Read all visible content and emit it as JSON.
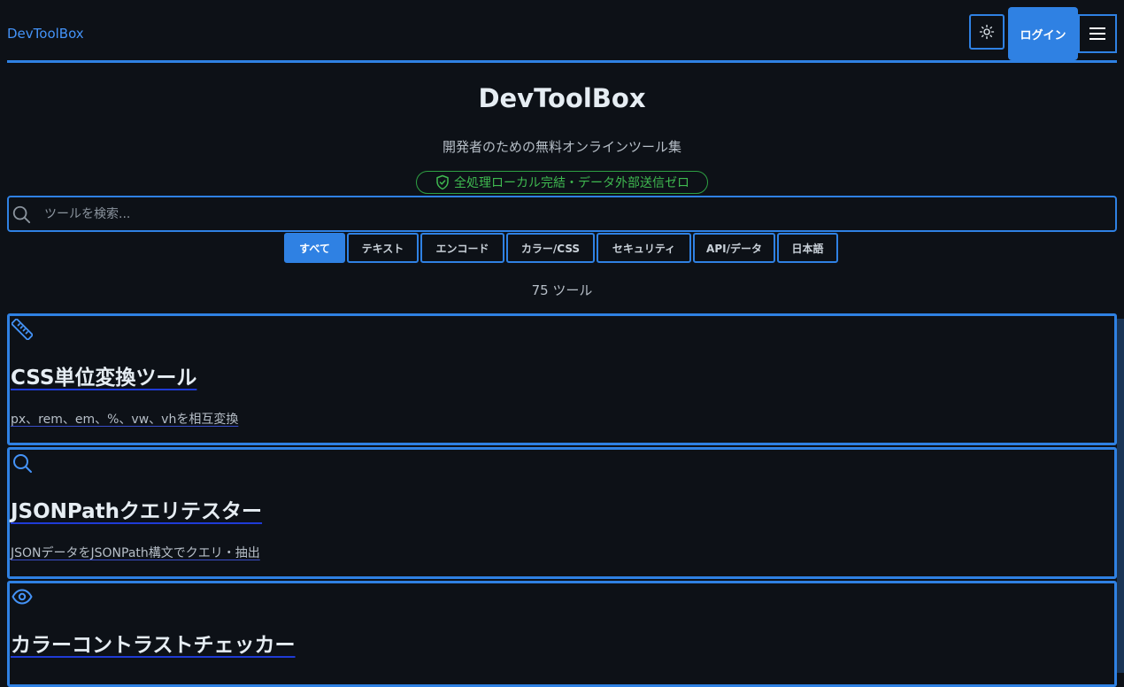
{
  "header": {
    "brand": "DevToolBox",
    "login_label": "ログイン",
    "theme_icon": "sun-icon",
    "menu_icon": "hamburger-menu-icon"
  },
  "hero": {
    "title": "DevToolBox",
    "subtitle": "開発者のための無料オンラインツール集",
    "privacy_badge": "全処理ローカル完結・データ外部送信ゼロ"
  },
  "search": {
    "placeholder": "ツールを検索..."
  },
  "tabs": [
    {
      "label": "すべて",
      "active": true
    },
    {
      "label": "テキスト",
      "active": false
    },
    {
      "label": "エンコード",
      "active": false
    },
    {
      "label": "カラー/CSS",
      "active": false
    },
    {
      "label": "セキュリティ",
      "active": false
    },
    {
      "label": "API/データ",
      "active": false
    },
    {
      "label": "日本語",
      "active": false
    }
  ],
  "count_label": "75 ツール",
  "tools": [
    {
      "icon": "ruler-icon",
      "title": "CSS単位変換ツール",
      "description": "px、rem、em、%、vw、vhを相互変換"
    },
    {
      "icon": "search-icon",
      "title": "JSONPathクエリテスター",
      "description": "JSONデータをJSONPath構文でクエリ・抽出"
    },
    {
      "icon": "eye-icon",
      "title": "カラーコントラストチェッカー",
      "description": ""
    }
  ],
  "colors": {
    "background": "#0d1117",
    "accent": "#2f81e3",
    "success": "#3fb950"
  }
}
